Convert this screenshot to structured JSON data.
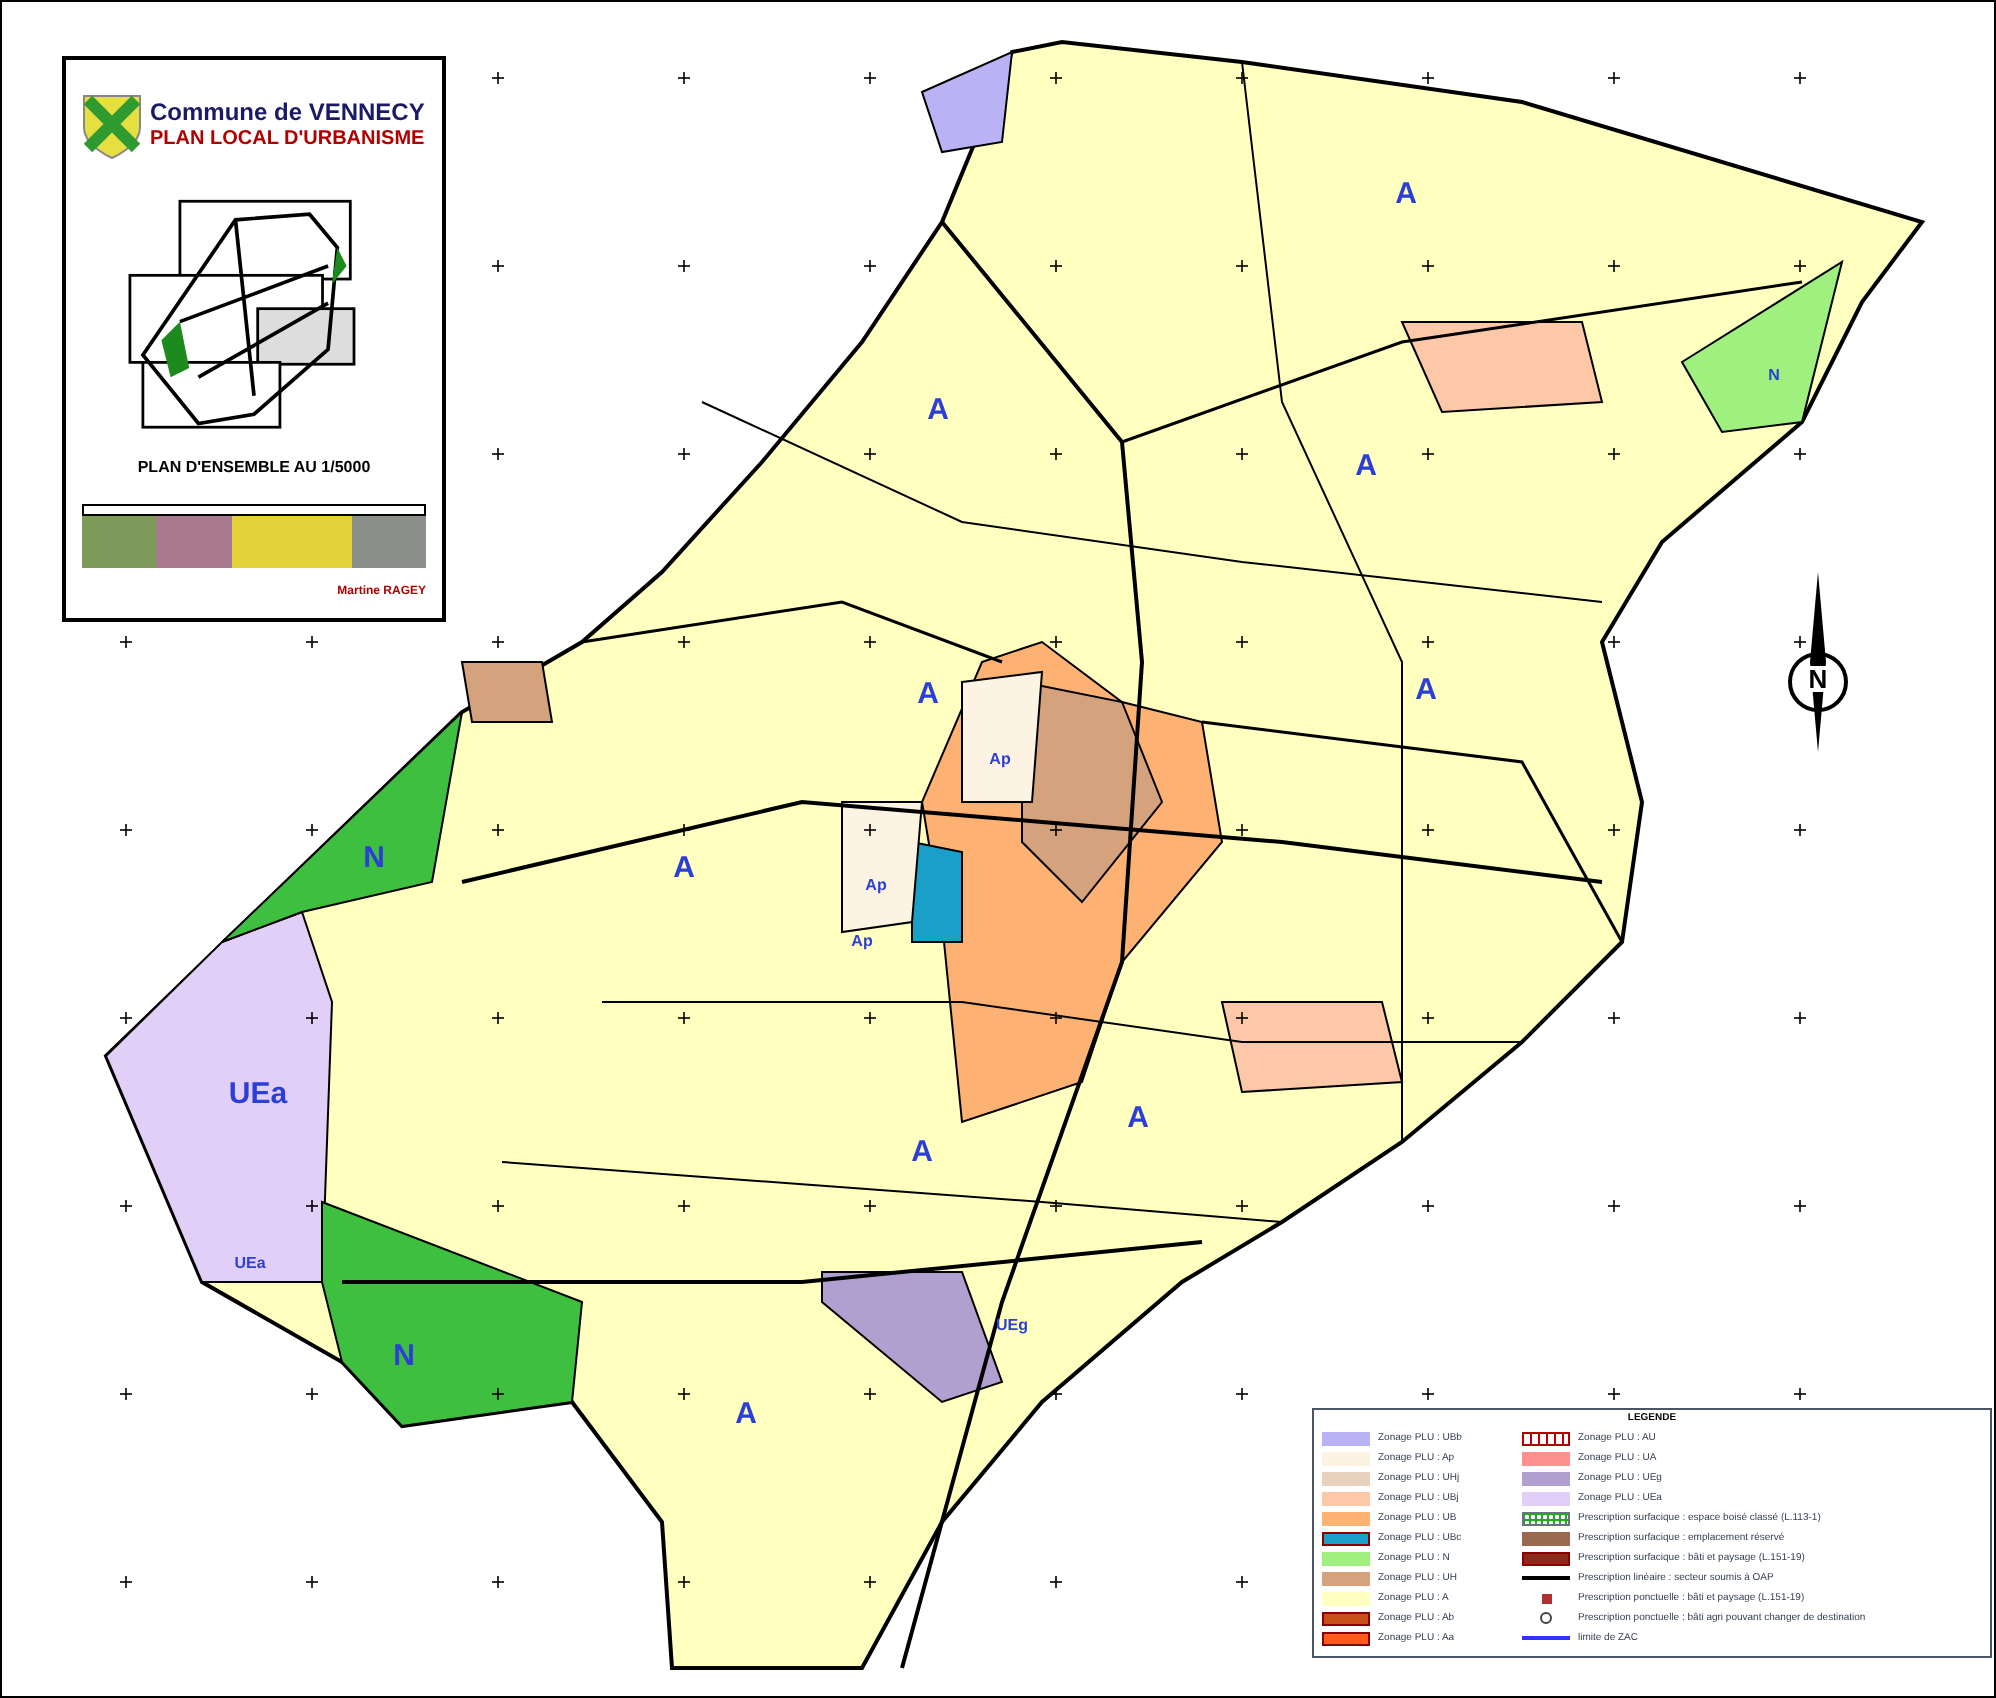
{
  "title_block": {
    "commune": "Commune de VENNECY",
    "document": "PLAN LOCAL D'URBANISME",
    "subtitle": "PLAN D'ENSEMBLE AU 1/5000",
    "author": "Martine RAGEY"
  },
  "map": {
    "zone_labels": [
      {
        "text": "A",
        "kind": "large"
      },
      {
        "text": "A",
        "kind": "large"
      },
      {
        "text": "A",
        "kind": "large"
      },
      {
        "text": "A",
        "kind": "large"
      },
      {
        "text": "A",
        "kind": "large"
      },
      {
        "text": "A",
        "kind": "large"
      },
      {
        "text": "A",
        "kind": "large"
      },
      {
        "text": "A",
        "kind": "large"
      },
      {
        "text": "A",
        "kind": "large"
      },
      {
        "text": "N",
        "kind": "large"
      },
      {
        "text": "N",
        "kind": "large"
      },
      {
        "text": "N",
        "kind": "small"
      },
      {
        "text": "UEa",
        "kind": "large"
      },
      {
        "text": "UEa",
        "kind": "small"
      },
      {
        "text": "Ap",
        "kind": "small"
      },
      {
        "text": "Ap",
        "kind": "small"
      },
      {
        "text": "Ap",
        "kind": "small"
      },
      {
        "text": "UEg",
        "kind": "small"
      }
    ]
  },
  "north_arrow": {
    "label": "N"
  },
  "legend": {
    "title": "LEGENDE",
    "items": [
      {
        "label": "Zonage PLU : UBb",
        "kind": "fill",
        "color": "#b9b3f5"
      },
      {
        "label": "Zonage PLU : Ap",
        "kind": "fill",
        "color": "#fdf3e3"
      },
      {
        "label": "Zonage PLU : UHj",
        "kind": "fill",
        "color": "#e8d2bd"
      },
      {
        "label": "Zonage PLU : UBj",
        "kind": "fill",
        "color": "#fcc8a8"
      },
      {
        "label": "Zonage PLU : UB",
        "kind": "fill",
        "color": "#fdb273"
      },
      {
        "label": "Zonage PLU : UBc",
        "kind": "bordered",
        "color": "#1aa0c8"
      },
      {
        "label": "Zonage PLU : N",
        "kind": "fill",
        "color": "#a0f080"
      },
      {
        "label": "Zonage PLU : UH",
        "kind": "fill",
        "color": "#d4a27c"
      },
      {
        "label": "Zonage PLU : A",
        "kind": "fill",
        "color": "#ffffc0"
      },
      {
        "label": "Zonage PLU : Ab",
        "kind": "bordered",
        "color": "#c94f1a"
      },
      {
        "label": "Zonage PLU : Aa",
        "kind": "bordered",
        "color": "#ff5a1a"
      },
      {
        "label": "Zonage PLU : AU",
        "kind": "stripes",
        "color": "#b00000"
      },
      {
        "label": "Zonage PLU : UA",
        "kind": "fill",
        "color": "#ff9090"
      },
      {
        "label": "Zonage PLU : UEg",
        "kind": "fill",
        "color": "#b0a0d0"
      },
      {
        "label": "Zonage PLU : UEa",
        "kind": "fill",
        "color": "#e2cff8"
      },
      {
        "label": "Prescription surfacique : espace boisé classé (L.113-1)",
        "kind": "dotted",
        "color": "#22aa22"
      },
      {
        "label": "Prescription surfacique : emplacement réservé",
        "kind": "fill",
        "color": "#9a6a50"
      },
      {
        "label": "Prescription surfacique : bâti et paysage (L.151-19)",
        "kind": "bordered",
        "color": "#8b2a1a"
      },
      {
        "label": "Prescription linéaire : secteur soumis à OAP",
        "kind": "line",
        "color": "#000000"
      },
      {
        "label": "Prescription ponctuelle : bâti et paysage (L.151-19)",
        "kind": "square",
        "color": "#b03030"
      },
      {
        "label": "Prescription ponctuelle : bâti agri pouvant changer de destination",
        "kind": "target",
        "color": "#444444"
      },
      {
        "label": "limite de ZAC",
        "kind": "line",
        "color": "#3333ff"
      }
    ]
  }
}
